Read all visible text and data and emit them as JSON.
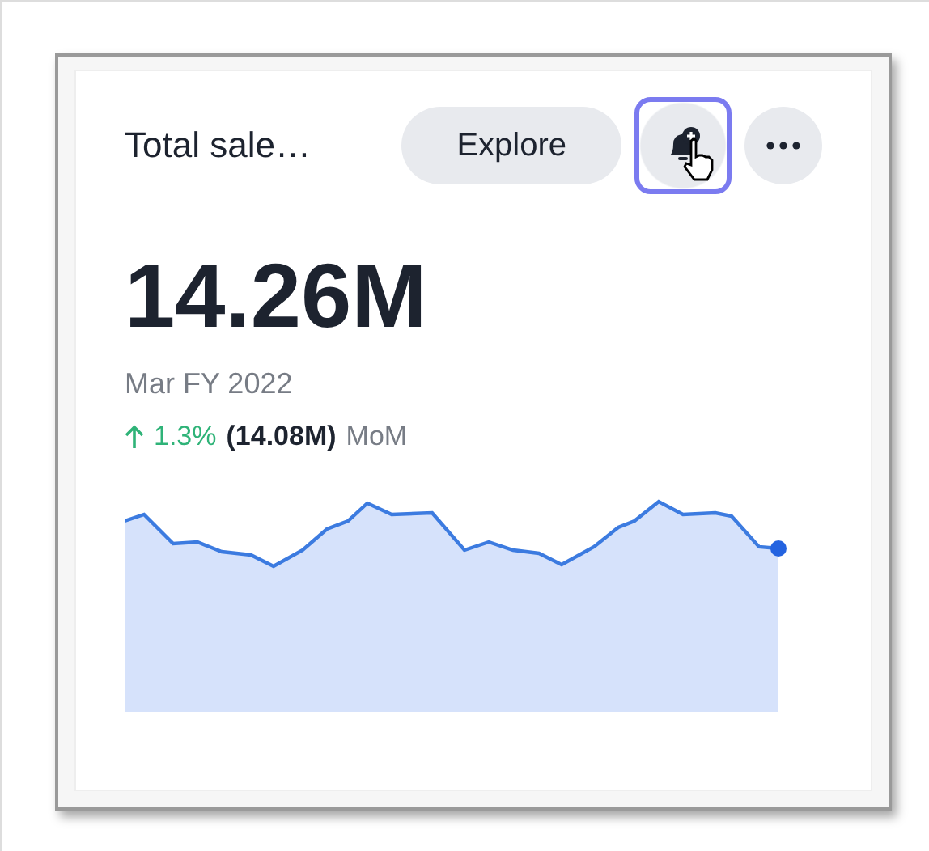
{
  "card": {
    "title": "Total sale…",
    "explore_button": {
      "label": "Explore"
    },
    "alert_button": {
      "focused": true
    },
    "value": "14.26M",
    "period": "Mar FY 2022",
    "change": {
      "rising": true,
      "percent": "1.3%",
      "previous": "(14.08M)",
      "basis": "MoM"
    }
  }
}
